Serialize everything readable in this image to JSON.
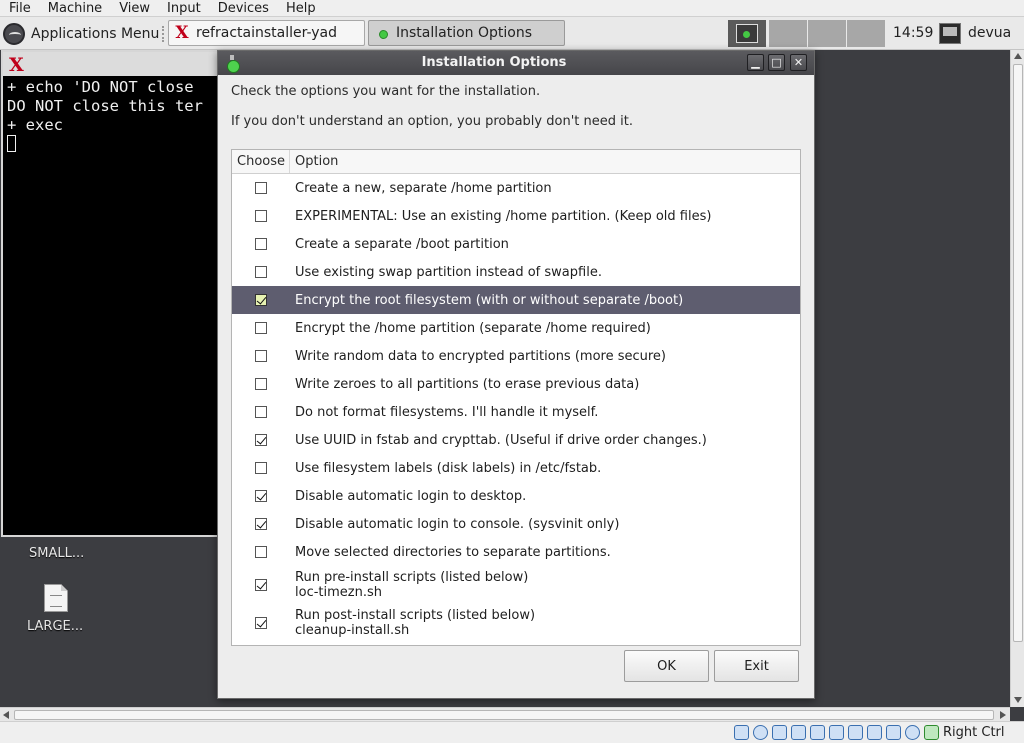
{
  "host_menubar": {
    "items": [
      "File",
      "Machine",
      "View",
      "Input",
      "Devices",
      "Help"
    ]
  },
  "panel": {
    "apps_menu_label": "Applications Menu",
    "tasks": [
      {
        "label": "refractainstaller-yad",
        "icon": "refracta-x-icon",
        "active": false
      },
      {
        "label": "Installation Options",
        "icon": "green-dot-app-icon",
        "active": true
      }
    ],
    "clock": "14:59",
    "user": "devua"
  },
  "terminal": {
    "lines": [
      "+ echo 'DO NOT close",
      "DO NOT close this ter",
      "+ exec"
    ]
  },
  "desktop": {
    "icon_labels": [
      "SMALL...",
      "LARGE..."
    ]
  },
  "dialog": {
    "title": "Installation Options",
    "intro_line1": "Check the options you want for the installation.",
    "intro_line2": "If you don't understand an option, you probably don't need it.",
    "columns": [
      "Choose",
      "Option"
    ],
    "options": [
      {
        "label": "Create a new, separate /home partition",
        "checked": false
      },
      {
        "label": "EXPERIMENTAL: Use an existing /home partition. (Keep old files)",
        "checked": false
      },
      {
        "label": "Create a separate /boot partition",
        "checked": false
      },
      {
        "label": "Use existing swap partition instead of swapfile.",
        "checked": false
      },
      {
        "label": "Encrypt the root filesystem (with or without separate /boot)",
        "checked": true,
        "selected": true
      },
      {
        "label": "Encrypt the /home partition (separate /home required)",
        "checked": false
      },
      {
        "label": "Write random data to encrypted partitions (more secure)",
        "checked": false
      },
      {
        "label": "Write zeroes to all partitions (to erase previous data)",
        "checked": false
      },
      {
        "label": "Do not format filesystems. I'll handle it myself.",
        "checked": false
      },
      {
        "label": "Use UUID in fstab and crypttab. (Useful if drive order changes.)",
        "checked": true
      },
      {
        "label": "Use filesystem labels (disk labels) in /etc/fstab.",
        "checked": false
      },
      {
        "label": "Disable automatic login to desktop.",
        "checked": true
      },
      {
        "label": "Disable automatic login to console. (sysvinit only)",
        "checked": true
      },
      {
        "label": "Move selected directories to separate partitions.",
        "checked": false
      },
      {
        "label": "Run pre-install scripts (listed below)",
        "sublabel": "loc-timezn.sh",
        "checked": true
      },
      {
        "label": "Run post-install scripts (listed below)",
        "sublabel": "cleanup-install.sh",
        "checked": true
      }
    ],
    "ok_label": "OK",
    "exit_label": "Exit"
  },
  "statusbar": {
    "host_key": "Right Ctrl"
  },
  "colors": {
    "selected_row": "#5e5d6f",
    "dialog_titlebar": "#4e4e52",
    "terminal_bg": "#000000",
    "desktop_bg": "#3c3d41"
  }
}
